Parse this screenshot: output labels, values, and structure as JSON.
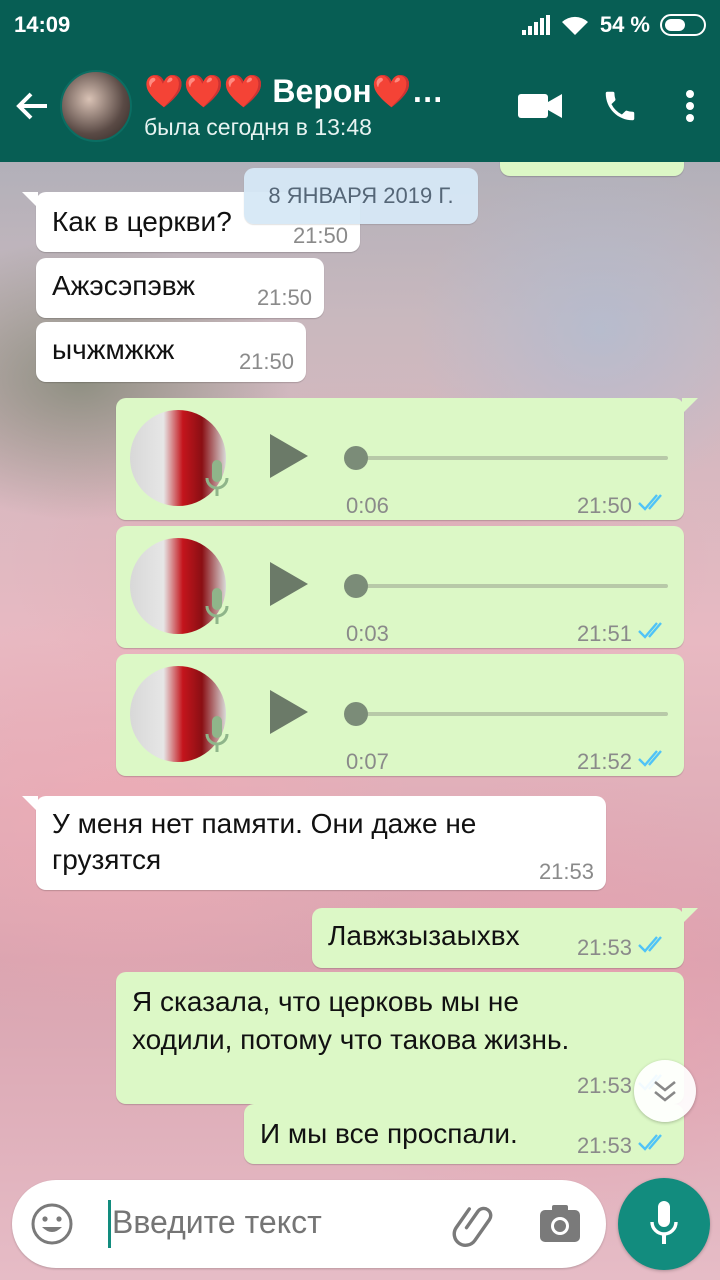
{
  "status_bar": {
    "time": "14:09",
    "battery": "54 %"
  },
  "header": {
    "contact_name": "❤️❤️❤️ Верон❤️…",
    "last_seen": "была сегодня в 13:48"
  },
  "chat": {
    "date_divider": "8 ЯНВАРЯ 2019 Г.",
    "messages": [
      {
        "dir": "in",
        "text": "Как в церкви?",
        "time": "21:50"
      },
      {
        "dir": "in",
        "text": "Ажэсэпэвж",
        "time": "21:50"
      },
      {
        "dir": "in",
        "text": "ычжмжкж",
        "time": "21:50"
      },
      {
        "dir": "out",
        "type": "voice",
        "duration": "0:06",
        "time": "21:50"
      },
      {
        "dir": "out",
        "type": "voice",
        "duration": "0:03",
        "time": "21:51"
      },
      {
        "dir": "out",
        "type": "voice",
        "duration": "0:07",
        "time": "21:52"
      },
      {
        "dir": "in",
        "text_line1": "У меня нет памяти. Они даже не",
        "text_line2": "грузятся",
        "time": "21:53"
      },
      {
        "dir": "out",
        "text": "Лавжзызаыхвх",
        "time": "21:53"
      },
      {
        "dir": "out",
        "text_line1": "Я сказала, что церковь мы не",
        "text_line2": "ходили, потому что такова жизнь.",
        "time": "21:53"
      },
      {
        "dir": "out",
        "text": "И мы все проспали.",
        "time": "21:53"
      }
    ]
  },
  "input": {
    "placeholder": "Введите текст"
  },
  "colors": {
    "header": "#075e54",
    "accent": "#128c7e",
    "outgoing": "#dcf8c6",
    "incoming": "#ffffff",
    "read_ticks": "#4fc3f7"
  },
  "icons": [
    "back-arrow-icon",
    "video-call-icon",
    "phone-icon",
    "more-vert-icon",
    "play-icon",
    "mic-icon",
    "double-check-icon",
    "scroll-down-icon",
    "emoji-icon",
    "attach-icon",
    "camera-icon"
  ]
}
